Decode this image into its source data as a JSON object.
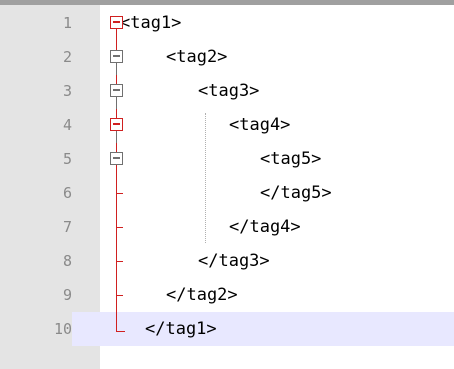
{
  "editor": {
    "lines": [
      {
        "number": "1",
        "text": "<tag1>"
      },
      {
        "number": "2",
        "text": "<tag2>"
      },
      {
        "number": "3",
        "text": "<tag3>"
      },
      {
        "number": "4",
        "text": "<tag4>"
      },
      {
        "number": "5",
        "text": "<tag5>"
      },
      {
        "number": "6",
        "text": "</tag5>"
      },
      {
        "number": "7",
        "text": "</tag4>"
      },
      {
        "number": "8",
        "text": "</tag3>"
      },
      {
        "number": "9",
        "text": "</tag2>"
      },
      {
        "number": "10",
        "text": "</tag1>"
      }
    ],
    "current_line": "10"
  },
  "colors": {
    "gutter": "#e4e4e4",
    "current_line_highlight": "#e8e8ff",
    "fold_active": "#d02020",
    "fold_inactive": "#707070",
    "line_number": "#8a8a8a"
  },
  "icons": {
    "fold_marker": "fold-collapse-minus-box"
  }
}
